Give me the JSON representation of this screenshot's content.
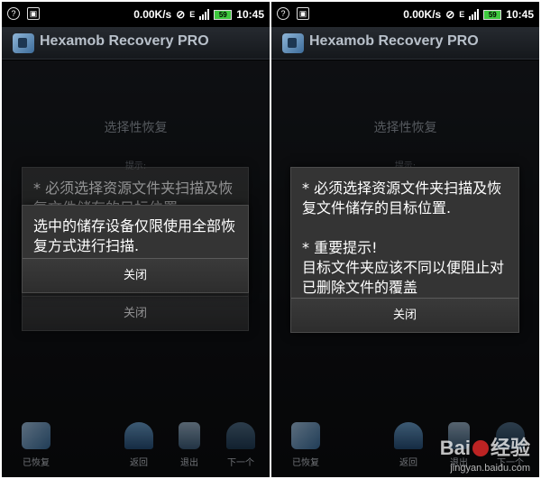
{
  "statusbar": {
    "speed": "0.00K/s",
    "network": "E",
    "battery": "59",
    "time": "10:45",
    "icons": [
      "wifi-question-icon",
      "image-icon",
      "mute-icon",
      "signal-icon",
      "battery-icon"
    ]
  },
  "app": {
    "title": "Hexamob Recovery PRO",
    "logo_icon": "app-logo-icon"
  },
  "screen": {
    "section_title": "选择性恢复",
    "hint_label": "提示:"
  },
  "left_dialog_back": {
    "message": "* 必须选择资源文件夹扫描及恢复文件储存的目标位置.",
    "button": "关闭"
  },
  "left_dialog_front": {
    "message": "选中的储存设备仅限使用全部恢复方式进行扫描.",
    "button": "关闭"
  },
  "left_dialog_faded_button": "关闭",
  "right_dialog": {
    "message": "* 必须选择资源文件夹扫描及恢复文件储存的目标位置.\n\n * 重要提示!\n 目标文件夹应该不同以便阻止对已删除文件的覆盖",
    "button": "关闭"
  },
  "bottombar": {
    "recovered": "已恢复",
    "back": "返回",
    "exit": "退出",
    "next": "下一个"
  },
  "watermark": {
    "brand_a": "Bai",
    "brand_b": "经验",
    "url": "jingyan.baidu.com"
  },
  "colors": {
    "background": "#000000",
    "dialog": "#343434",
    "battery": "#3ec83e"
  }
}
